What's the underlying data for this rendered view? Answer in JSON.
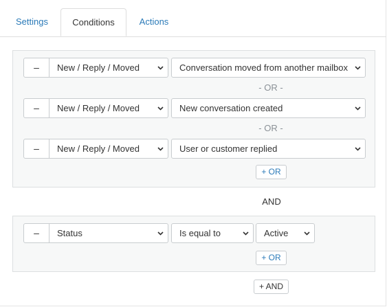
{
  "tabs": [
    {
      "label": "Settings"
    },
    {
      "label": "Conditions"
    },
    {
      "label": "Actions"
    }
  ],
  "active_tab": "Conditions",
  "group1": {
    "rows": [
      {
        "remove_label": "–",
        "event": "New / Reply / Moved",
        "condition": "Conversation moved from another mailbox"
      },
      {
        "remove_label": "–",
        "event": "New / Reply / Moved",
        "condition": "New conversation created"
      },
      {
        "remove_label": "–",
        "event": "New / Reply / Moved",
        "condition": "User or customer replied"
      }
    ],
    "separator": "- OR -",
    "add_or_label": "+ OR"
  },
  "and_label": "AND",
  "group2": {
    "row": {
      "remove_label": "–",
      "field": "Status",
      "operator": "Is equal to",
      "value": "Active"
    },
    "add_or_label": "+ OR"
  },
  "add_and_label": "+ AND",
  "colors": {
    "link": "#2a7ab8",
    "group_bg": "#f7f8f8",
    "border": "#c8cccf"
  }
}
